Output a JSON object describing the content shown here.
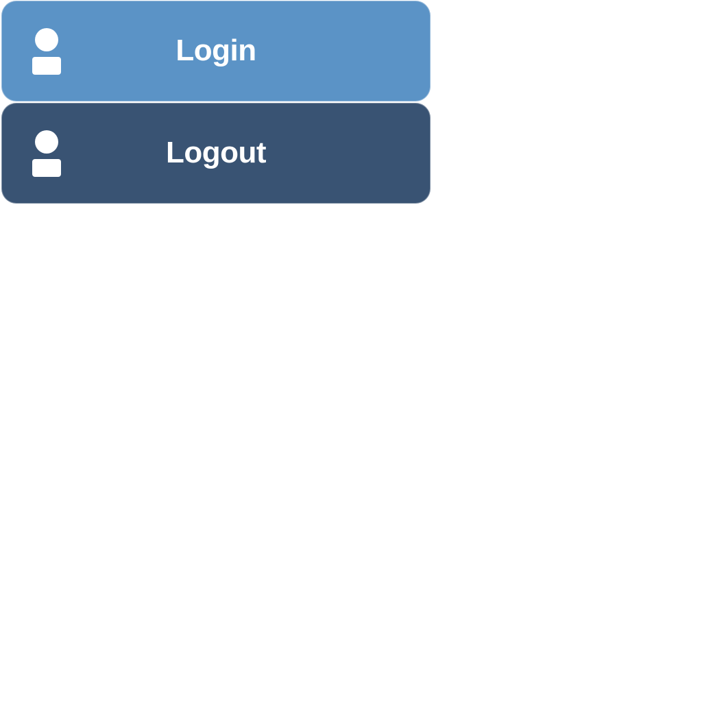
{
  "buttons": [
    {
      "id": "login",
      "label": "Login",
      "icon": "user-icon",
      "background": "#5b93c6"
    },
    {
      "id": "logout",
      "label": "Logout",
      "icon": "user-icon",
      "background": "#395373"
    }
  ],
  "colors": {
    "text": "#ffffff",
    "page_background": "#ffffff"
  }
}
